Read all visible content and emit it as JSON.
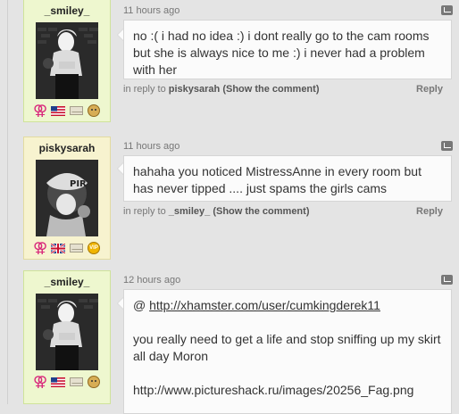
{
  "comments": [
    {
      "username": "_smiley_",
      "time": "11 hours ago",
      "text": "no :( i had no idea :) i dont really go to the cam rooms but she is always nice to me :) i never had a problem with her",
      "reply_prefix": "in reply to",
      "reply_target": "piskysarah",
      "show_comment": "(Show the comment)",
      "reply_label": "Reply",
      "icons": [
        "female-gender-icon",
        "us-flag-icon",
        "envelope-icon",
        "dog-badge-icon"
      ]
    },
    {
      "username": "piskysarah",
      "time": "11 hours ago",
      "text": "hahaha you noticed MistressAnne in every room but has never tipped .... just spams the girls cams",
      "reply_prefix": "in reply to",
      "reply_target": "_smiley_",
      "show_comment": "(Show the comment)",
      "reply_label": "Reply",
      "icons": [
        "female-gender-icon",
        "uk-flag-icon",
        "envelope-icon",
        "vip-badge-icon"
      ],
      "vip_text": "VIP"
    },
    {
      "username": "_smiley_",
      "time": "12 hours ago",
      "mention_at": "@",
      "mention_link": "http://xhamster.com/user/cumkingderek11",
      "paragraph1": "you really need to get a life and stop sniffing up my skirt all day Moron",
      "paragraph2": "http://www.pictureshack.ru/images/20256_Fag.png",
      "icons": [
        "female-gender-icon",
        "us-flag-icon",
        "envelope-icon",
        "dog-badge-icon"
      ]
    }
  ]
}
